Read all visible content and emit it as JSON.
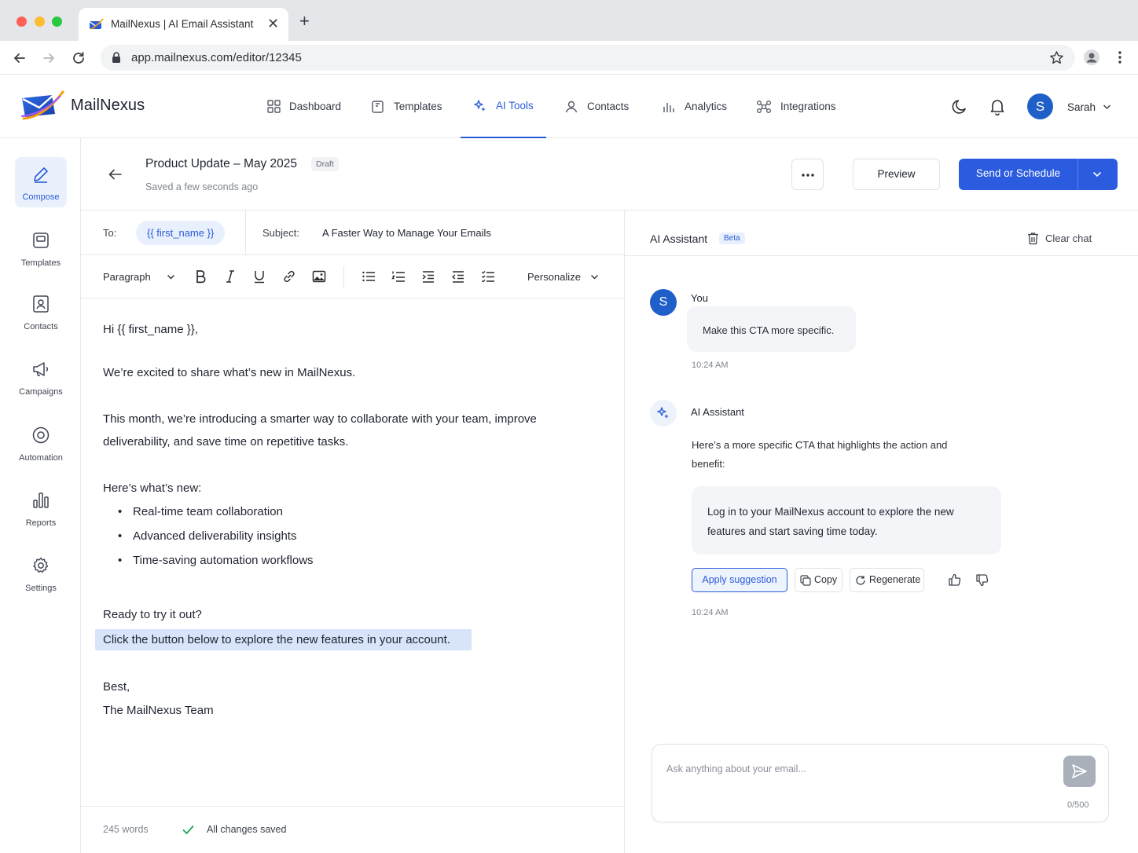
{
  "browser": {
    "tab_title": "MailNexus | AI Email Assistant",
    "url": "app.mailnexus.com/editor/12345",
    "traffic_lights": [
      "#ff5f57",
      "#febc2e",
      "#28c840"
    ]
  },
  "app": {
    "brand": "MailNexus",
    "accent": "#2b5ce0",
    "nav": [
      {
        "label": "Dashboard",
        "icon": "grid-icon"
      },
      {
        "label": "Templates",
        "icon": "template-icon"
      },
      {
        "label": "AI Tools",
        "icon": "sparkle-icon",
        "active": true
      },
      {
        "label": "Contacts",
        "icon": "user-icon"
      },
      {
        "label": "Analytics",
        "icon": "bar-chart-icon"
      },
      {
        "label": "Integrations",
        "icon": "puzzle-icon"
      }
    ],
    "user": {
      "initial": "S",
      "name": "Sarah"
    }
  },
  "sidebar": {
    "items": [
      {
        "label": "Compose",
        "icon": "pencil-icon",
        "active": true
      },
      {
        "label": "Templates",
        "icon": "template-icon"
      },
      {
        "label": "Contacts",
        "icon": "contact-card-icon"
      },
      {
        "label": "Campaigns",
        "icon": "megaphone-icon"
      },
      {
        "label": "Automation",
        "icon": "automation-icon"
      },
      {
        "label": "Reports",
        "icon": "bar-chart-icon"
      },
      {
        "label": "Settings",
        "icon": "gear-icon"
      }
    ]
  },
  "compose": {
    "title": "Product Update – May 2025",
    "badge": "Draft",
    "saved": "Saved a few seconds ago",
    "preview_label": "Preview",
    "send_label": "Send or Schedule",
    "to_label": "To:",
    "to_chip": "{{ first_name }}",
    "subject_label": "Subject:",
    "subject_value": "A Faster Way to Manage Your Emails",
    "format": {
      "paragraph": "Paragraph",
      "personalize": "Personalize"
    },
    "body": {
      "greeting": "Hi {{ first_name }},",
      "p1": "We’re excited to share what’s new in MailNexus.",
      "p2_line1": "This month, we’re introducing a smarter way to collaborate with your team, improve",
      "p2_line2": "deliverability, and save time on repetitive tasks.",
      "p3": "Here’s what’s new:",
      "bullets": [
        "Real-time team collaboration",
        "Advanced deliverability insights",
        "Time-saving automation workflows"
      ],
      "p4": "Ready to try it out?",
      "cta": "Click the button below to explore the new features in your account.",
      "signoff": "Best,",
      "signature": "The MailNexus Team"
    },
    "word_count": "245 words",
    "save_status": "All changes saved"
  },
  "ai": {
    "title": "AI Assistant",
    "badge": "Beta",
    "clear": "Clear chat",
    "user_name": "You",
    "user_initial": "S",
    "user_msg": "Make this CTA more specific.",
    "user_time": "10:24 AM",
    "ai_name": "AI Assistant",
    "ai_msg": "Here’s a more specific CTA that highlights the action and benefit:",
    "suggestion": "Log in to your MailNexus account to explore the new features and start saving time today.",
    "apply_label": "Apply suggestion",
    "copy_label": "Copy",
    "regen_label": "Regenerate",
    "ai_time": "10:24 AM",
    "placeholder": "Ask anything about your email...",
    "char_count": "0/500"
  }
}
